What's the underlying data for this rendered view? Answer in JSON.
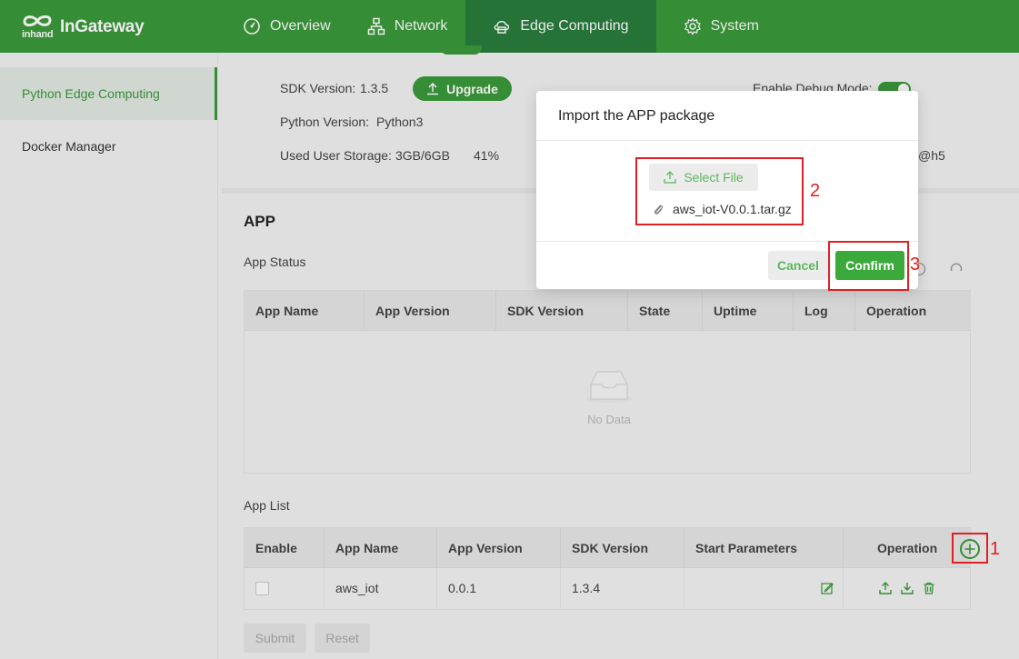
{
  "brand": {
    "name": "InGateway",
    "sub": "inhand"
  },
  "nav": [
    {
      "label": "Overview",
      "icon": "gauge-icon"
    },
    {
      "label": "Network",
      "icon": "network-icon"
    },
    {
      "label": "Edge Computing",
      "icon": "cloud-server-icon",
      "active": true
    },
    {
      "label": "System",
      "icon": "gear-icon"
    }
  ],
  "sidebar": {
    "items": [
      {
        "label": "Python Edge Computing",
        "active": true
      },
      {
        "label": "Docker Manager"
      }
    ]
  },
  "sdk": {
    "version_label": "SDK Version:",
    "version_value": "1.3.5",
    "upgrade_label": "Upgrade",
    "python_label": "Python Version:",
    "python_value": "Python3",
    "storage_label": "Used User Storage:",
    "storage_value": "3GB/6GB",
    "storage_percent": "41%",
    "debug_label": "Enable Debug Mode:",
    "debug_enabled": true,
    "right_partial": "@h5"
  },
  "app": {
    "title": "APP",
    "status_title": "App Status",
    "status_columns": [
      "App Name",
      "App Version",
      "SDK Version",
      "State",
      "Uptime",
      "Log",
      "Operation"
    ],
    "no_data": "No Data",
    "list_title": "App List",
    "list_columns": [
      "Enable",
      "App Name",
      "App Version",
      "SDK Version",
      "Start Parameters",
      "Operation"
    ],
    "rows": [
      {
        "enabled": false,
        "name": "aws_iot",
        "version": "0.0.1",
        "sdk": "1.3.4",
        "params": ""
      }
    ],
    "submit_label": "Submit",
    "reset_label": "Reset"
  },
  "dialog": {
    "title": "Import the APP package",
    "select_file_label": "Select File",
    "file_name": "aws_iot-V0.0.1.tar.gz",
    "cancel_label": "Cancel",
    "confirm_label": "Confirm"
  },
  "annotations": [
    "1",
    "2",
    "3"
  ],
  "colors": {
    "primary": "#3a9a3a",
    "header_active": "#2a7d3d",
    "annotation": "#e02020"
  }
}
